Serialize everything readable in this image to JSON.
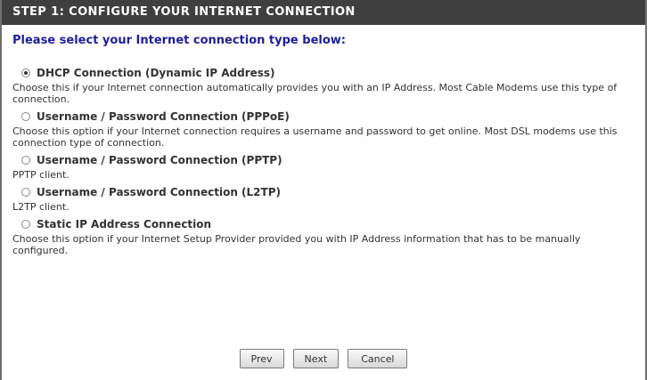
{
  "header": {
    "title": "STEP 1: CONFIGURE YOUR INTERNET CONNECTION"
  },
  "prompt": "Please select your Internet connection type below:",
  "options": [
    {
      "label": "DHCP Connection (Dynamic IP Address)",
      "description": "Choose this if your Internet connection automatically provides you with an IP Address. Most Cable Modems use this type of connection.",
      "checked": true
    },
    {
      "label": "Username / Password Connection (PPPoE)",
      "description": "Choose this option if your Internet connection requires a username and password to get online. Most DSL modems use this connection type of connection.",
      "checked": false
    },
    {
      "label": "Username / Password Connection (PPTP)",
      "description": "PPTP client.",
      "checked": false
    },
    {
      "label": "Username / Password Connection (L2TP)",
      "description": "L2TP client.",
      "checked": false
    },
    {
      "label": "Static IP Address Connection",
      "description": "Choose this option if your Internet Setup Provider provided you with IP Address information that has to be manually configured.",
      "checked": false
    }
  ],
  "buttons": {
    "prev": "Prev",
    "next": "Next",
    "cancel": "Cancel"
  }
}
